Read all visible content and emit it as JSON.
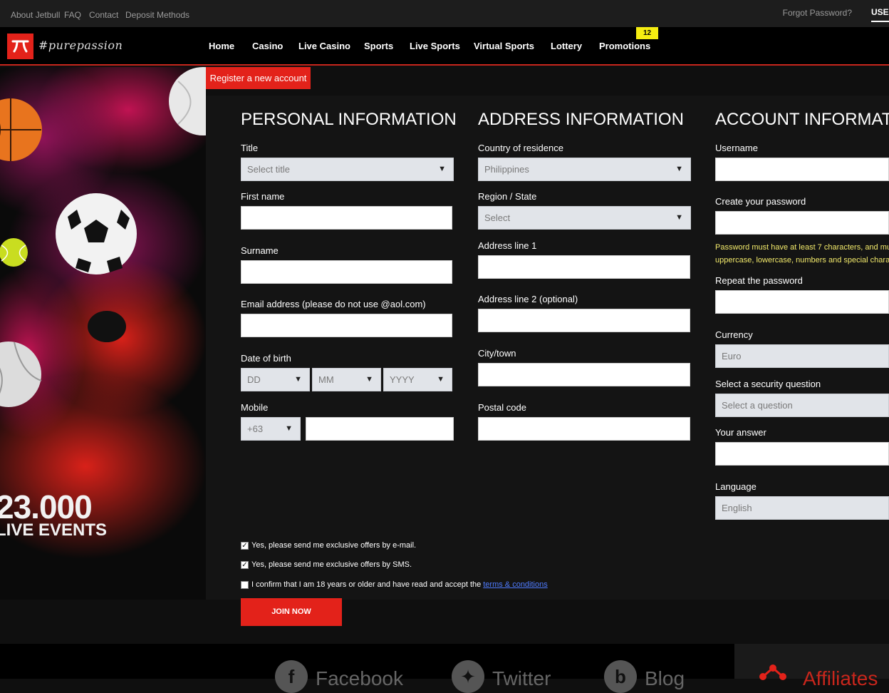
{
  "topbar": {
    "links": [
      "About Jetbull",
      "FAQ",
      "Contact",
      "Deposit Methods"
    ],
    "forgot_password": "Forgot Password?",
    "user_label": "USER"
  },
  "nav": {
    "tagline": "#purepassion",
    "items": [
      "Home",
      "Casino",
      "Live Casino",
      "Sports",
      "Live Sports",
      "Virtual Sports",
      "Lottery",
      "Promotions"
    ],
    "promotions_badge": "12"
  },
  "hero": {
    "number": "23.000",
    "label": "LIVE EVENTS"
  },
  "register_tab": "Register a new account",
  "personal": {
    "title": "PERSONAL INFORMATION",
    "title_label": "Title",
    "title_select": "Select title",
    "first_name_label": "First name",
    "surname_label": "Surname",
    "email_label": "Email address (please do not use @aol.com)",
    "dob_label": "Date of birth",
    "dob_day": "DD",
    "dob_month": "MM",
    "dob_year": "YYYY",
    "mobile_label": "Mobile",
    "mobile_prefix": "+63"
  },
  "address": {
    "title": "ADDRESS INFORMATION",
    "country_label": "Country of residence",
    "country_value": "Philippines",
    "region_label": "Region / State",
    "region_value": "Select",
    "line1_label": "Address line 1",
    "line2_label": "Address line 2 (optional)",
    "city_label": "City/town",
    "postal_label": "Postal code"
  },
  "account": {
    "title": "ACCOUNT INFORMATIO",
    "username_label": "Username",
    "password_label": "Create your password",
    "password_hint_1": "Password must have at least 7 characters, and mu",
    "password_hint_2": "uppercase, lowercase, numbers and special chara",
    "repeat_label": "Repeat the password",
    "currency_label": "Currency",
    "currency_value": "Euro",
    "security_label": "Select a security question",
    "security_value": "Select a question",
    "answer_label": "Your answer",
    "language_label": "Language",
    "language_value": "English"
  },
  "consents": {
    "email_offers": "Yes, please send me exclusive offers by e-mail.",
    "email_offers_checked": true,
    "sms_offers": "Yes, please send me exclusive offers by SMS.",
    "sms_offers_checked": true,
    "age_confirm": "I confirm that I am 18 years or older and have read and accept the",
    "age_confirm_checked": false,
    "terms_link": "terms & conditions"
  },
  "join_button": "JOIN NOW",
  "footer": {
    "facebook": "Facebook",
    "twitter": "Twitter",
    "blog": "Blog",
    "affiliates": "Affiliates"
  },
  "colors": {
    "brand_red": "#e3221a",
    "badge_yellow": "#f5ed11",
    "hint_yellow": "#f3ea6b",
    "link_blue": "#4f7cff"
  }
}
